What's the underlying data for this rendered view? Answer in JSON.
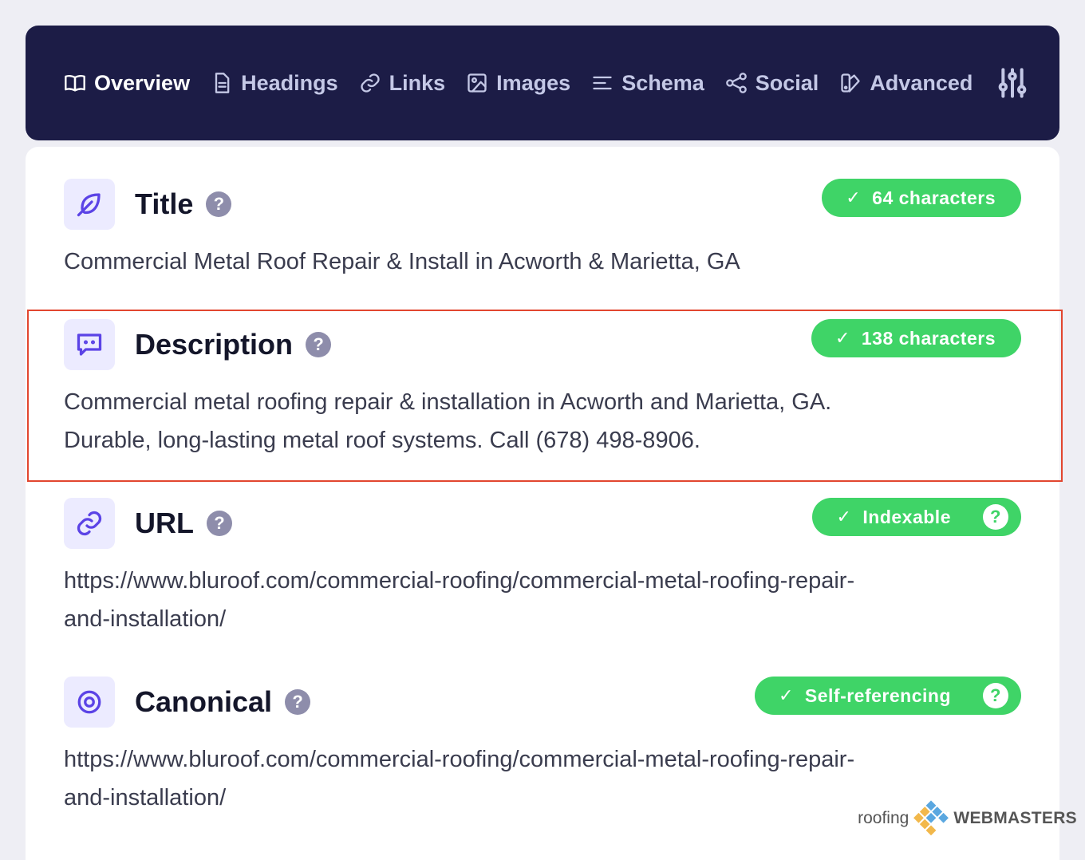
{
  "nav": {
    "tabs": [
      {
        "label": "Overview",
        "icon": "book-icon",
        "active": true
      },
      {
        "label": "Headings",
        "icon": "document-icon"
      },
      {
        "label": "Links",
        "icon": "link-icon"
      },
      {
        "label": "Images",
        "icon": "image-icon"
      },
      {
        "label": "Schema",
        "icon": "list-icon"
      },
      {
        "label": "Social",
        "icon": "share-icon"
      },
      {
        "label": "Advanced",
        "icon": "swatch-icon"
      }
    ],
    "settings_icon": "sliders-icon"
  },
  "sections": {
    "title": {
      "heading": "Title",
      "icon": "leaf-icon",
      "badge": "64 characters",
      "text": "Commercial Metal Roof Repair & Install in Acworth & Marietta, GA"
    },
    "description": {
      "heading": "Description",
      "icon": "chat-icon",
      "badge": "138 characters",
      "line1": "Commercial metal roofing repair & installation in Acworth and Marietta, GA.",
      "line2": "Durable, long-lasting metal roof systems. Call (678) 498-8906."
    },
    "url": {
      "heading": "URL",
      "icon": "link-icon",
      "badge": "Indexable",
      "line1": "https://www.bluroof.com/commercial-roofing/commercial-metal-roofing-repair-",
      "line2": "and-installation/"
    },
    "canonical": {
      "heading": "Canonical",
      "icon": "target-icon",
      "badge": "Self-referencing",
      "line1": "https://www.bluroof.com/commercial-roofing/commercial-metal-roofing-repair-",
      "line2": "and-installation/"
    }
  },
  "symbols": {
    "help": "?",
    "check": "✓"
  },
  "watermark": {
    "left": "roofing",
    "right": "WEBMASTERS"
  },
  "colors": {
    "nav_bg": "#1c1c46",
    "accent": "#5b43e6",
    "badge_green": "#3fd467",
    "highlight": "#e2462f"
  }
}
